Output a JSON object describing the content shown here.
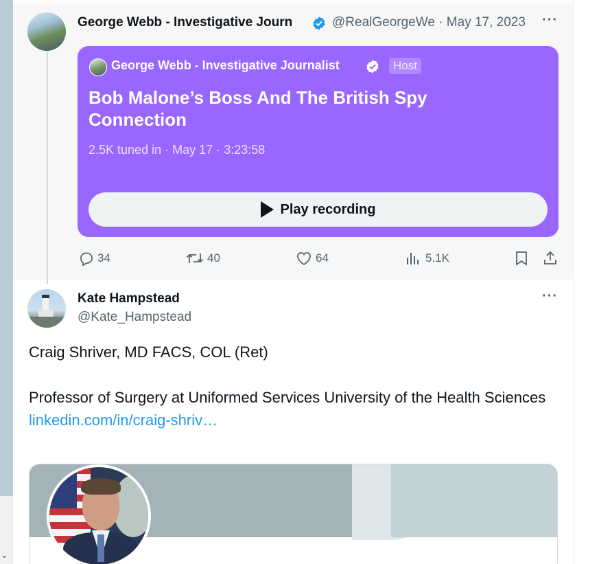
{
  "tweet1": {
    "author_name": "George Webb - Investigative Journalist",
    "author_name_truncated": "George Webb - Investigative Journ",
    "handle": "@RealGeorgeWe",
    "separator": "·",
    "date": "May 17, 2023",
    "space": {
      "host_name": "George Webb - Investigative Journalist",
      "host_badge": "Host",
      "title": "Bob Malone’s Boss And The British Spy Connection",
      "tuned_in": "2.5K tuned in",
      "date": "May 17",
      "duration": "3:23:58",
      "play_label": "Play recording"
    },
    "actions": {
      "replies": "34",
      "reposts": "40",
      "likes": "64",
      "views": "5.1K"
    }
  },
  "tweet2": {
    "author_name": "Kate Hampstead",
    "handle": "@Kate_Hampstead",
    "body_line1": "Craig Shriver, MD FACS, COL (Ret)",
    "body_line2": "Professor of Surgery at Uniformed Services University of the Health Sciences",
    "link_text": "linkedin.com/in/craig-shriv…"
  },
  "colors": {
    "space_purple": "#9966ff",
    "verified_blue": "#1d9bf0",
    "link_blue": "#1d9bf0",
    "muted_text": "#536471"
  },
  "icons": [
    "verified-badge-icon",
    "more-icon",
    "play-icon",
    "reply-icon",
    "repost-icon",
    "like-icon",
    "views-icon",
    "bookmark-icon",
    "share-icon",
    "chevron-down-icon"
  ]
}
